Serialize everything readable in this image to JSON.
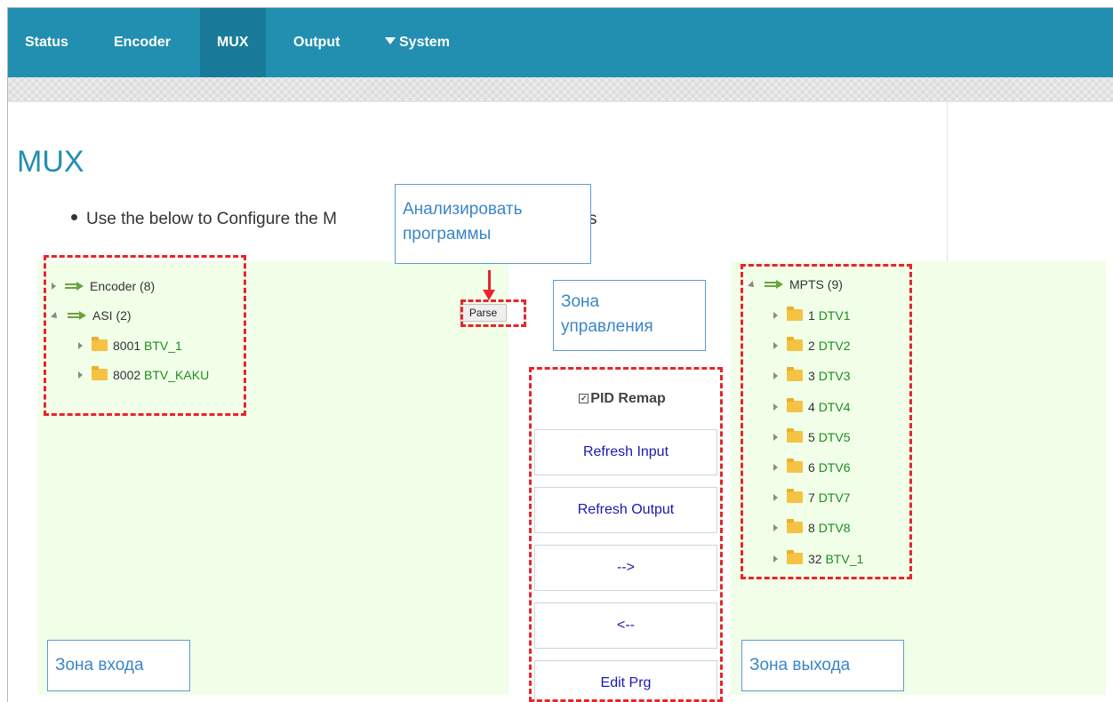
{
  "nav": {
    "items": [
      {
        "label": "Status"
      },
      {
        "label": "Encoder"
      },
      {
        "label": "MUX"
      },
      {
        "label": "Output"
      },
      {
        "label": "System"
      }
    ],
    "active": "MUX"
  },
  "page": {
    "title": "MUX",
    "description": "Use the below to Configure the M",
    "description_tail": "s"
  },
  "input_tree": {
    "nodes": [
      {
        "name": "Encoder",
        "count": "(8)"
      },
      {
        "name": "ASI",
        "count": "(2)"
      }
    ],
    "programs": [
      {
        "num": "8001",
        "name": "BTV_1"
      },
      {
        "num": "8002",
        "name": "BTV_KAKU"
      }
    ]
  },
  "controls": {
    "parse_label": "Parse",
    "pid_remap_label": "PID Remap",
    "pid_remap_checked": true,
    "refresh_input_label": "Refresh Input",
    "refresh_output_label": "Refresh Output",
    "add_label": "-->",
    "remove_label": "<--",
    "edit_prg_label": "Edit Prg"
  },
  "output_tree": {
    "root": {
      "name": "MPTS",
      "count": "(9)"
    },
    "programs": [
      {
        "num": "1",
        "name": "DTV1"
      },
      {
        "num": "2",
        "name": "DTV2"
      },
      {
        "num": "3",
        "name": "DTV3"
      },
      {
        "num": "4",
        "name": "DTV4"
      },
      {
        "num": "5",
        "name": "DTV5"
      },
      {
        "num": "6",
        "name": "DTV6"
      },
      {
        "num": "7",
        "name": "DTV7"
      },
      {
        "num": "8",
        "name": "DTV8"
      },
      {
        "num": "32",
        "name": "BTV_1"
      }
    ]
  },
  "annotations": {
    "analyze_line1": "Анализировать",
    "analyze_line2": "программы",
    "control_line1": "Зона",
    "control_line2": "управления",
    "input_zone": "Зона входа",
    "output_zone": "Зона выхода"
  },
  "colors": {
    "navbar": "#238fb0",
    "nav_active": "#197a99",
    "panel_bg": "#f1ffe9",
    "program_name": "#1c8d1c",
    "annotation_dash": "#e8242a",
    "callout_text": "#3a86c8"
  }
}
